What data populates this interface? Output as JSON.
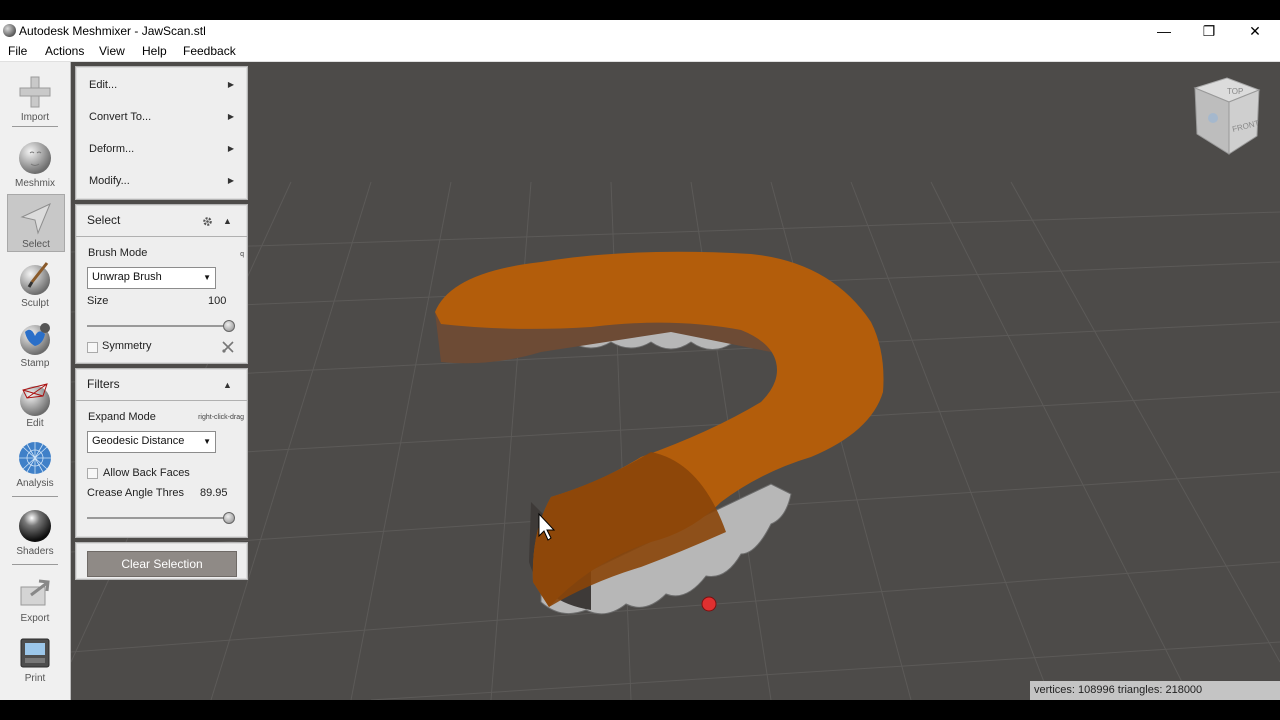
{
  "window": {
    "title": "Autodesk Meshmixer - JawScan.stl",
    "minimize": "—",
    "restore": "❐",
    "close": "✕"
  },
  "menu": [
    "File",
    "Actions",
    "View",
    "Help",
    "Feedback"
  ],
  "toolbar": [
    {
      "label": "Import",
      "icon": "import-icon"
    },
    {
      "label": "Meshmix",
      "icon": "meshmix-icon"
    },
    {
      "label": "Select",
      "icon": "select-icon",
      "active": true
    },
    {
      "label": "Sculpt",
      "icon": "sculpt-icon"
    },
    {
      "label": "Stamp",
      "icon": "stamp-icon"
    },
    {
      "label": "Edit",
      "icon": "edit-icon"
    },
    {
      "label": "Analysis",
      "icon": "analysis-icon"
    },
    {
      "label": "Shaders",
      "icon": "shaders-icon"
    },
    {
      "label": "Export",
      "icon": "export-icon"
    },
    {
      "label": "Print",
      "icon": "print-icon"
    }
  ],
  "submenu": [
    {
      "label": "Edit...",
      "arrow": "▶"
    },
    {
      "label": "Convert To...",
      "arrow": "▶"
    },
    {
      "label": "Deform...",
      "arrow": "▶"
    },
    {
      "label": "Modify...",
      "arrow": "▶"
    }
  ],
  "select_panel": {
    "title": "Select",
    "collapse": "▲",
    "brush_mode_label": "Brush Mode",
    "brush_mode_hotkey": "q",
    "brush_mode_value": "Unwrap Brush",
    "dropdown_arrow": "▼",
    "size_label": "Size",
    "size_value": "100",
    "size_fraction": 1.0,
    "symmetry_label": "Symmetry"
  },
  "filters_panel": {
    "title": "Filters",
    "collapse": "▲",
    "expand_mode_label": "Expand Mode",
    "expand_mode_hint": "right-click-drag",
    "expand_mode_value": "Geodesic Distance",
    "dropdown_arrow": "▼",
    "allow_back_faces_label": "Allow Back Faces",
    "crease_label": "Crease Angle Thres",
    "crease_value": "89.95",
    "crease_fraction": 1.0
  },
  "clear_button": "Clear Selection",
  "view_cube": {
    "top": "TOP",
    "front": "FRONT"
  },
  "status": "vertices: 108996 triangles: 218000",
  "colors": {
    "viewport": "#4d4b49",
    "grid": "#5e5c5a",
    "selection_orange": "#b8600c",
    "selection_dark": "#8a4308"
  }
}
